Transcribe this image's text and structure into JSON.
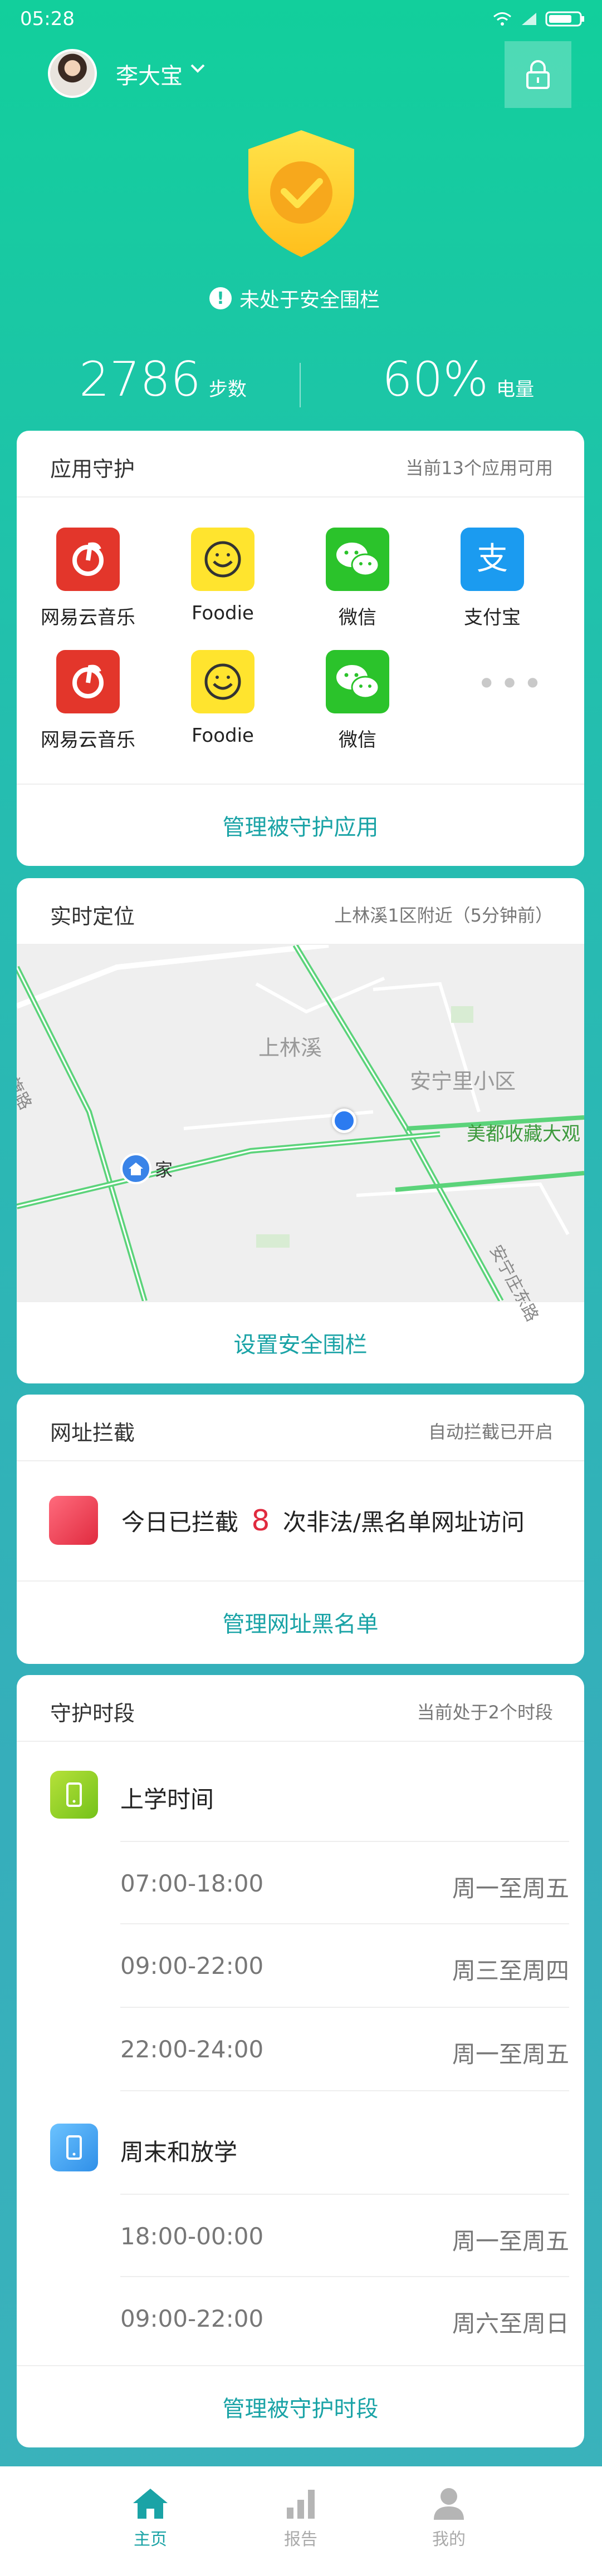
{
  "status_bar": {
    "time": "05:28"
  },
  "header": {
    "user_name": "李大宝",
    "warning_text": "未处于安全围栏",
    "steps_value": "2786",
    "steps_unit": "步数",
    "battery_value": "60%",
    "battery_unit": "电量"
  },
  "app_guard": {
    "title": "应用守护",
    "subtitle": "当前13个应用可用",
    "apps": [
      {
        "label": "网易云音乐",
        "icon": "netease-music-icon"
      },
      {
        "label": "Foodie",
        "icon": "foodie-icon"
      },
      {
        "label": "微信",
        "icon": "wechat-icon"
      },
      {
        "label": "支付宝",
        "icon": "alipay-icon"
      },
      {
        "label": "网易云音乐",
        "icon": "netease-music-icon"
      },
      {
        "label": "Foodie",
        "icon": "foodie-icon"
      },
      {
        "label": "微信",
        "icon": "wechat-icon"
      }
    ],
    "more_label": "•••",
    "footer": "管理被守护应用"
  },
  "location": {
    "title": "实时定位",
    "subtitle": "上林溪1区附近（5分钟前）",
    "map_labels": {
      "shanglinxi": "上林溪",
      "anningli": "安宁里小区",
      "meidu": "美都收藏大观",
      "home": "家",
      "road_left": "西二旗路",
      "road_right": "安宁庄东路"
    },
    "footer": "设置安全围栏"
  },
  "url_block": {
    "title": "网址拦截",
    "subtitle": "自动拦截已开启",
    "prefix": "今日已拦截",
    "count": "8",
    "suffix": "次非法/黑名单网址访问",
    "footer": "管理网址黑名单"
  },
  "time_guard": {
    "title": "守护时段",
    "subtitle": "当前处于2个时段",
    "groups": [
      {
        "name": "上学时间",
        "color": "#8ccf1e",
        "slots": [
          {
            "time": "07:00-18:00",
            "days": "周一至周五"
          },
          {
            "time": "09:00-22:00",
            "days": "周三至周四"
          },
          {
            "time": "22:00-24:00",
            "days": "周一至周五"
          }
        ]
      },
      {
        "name": "周末和放学",
        "color": "#3aa0f0",
        "slots": [
          {
            "time": "18:00-00:00",
            "days": "周一至周五"
          },
          {
            "time": "09:00-22:00",
            "days": "周六至周日"
          }
        ]
      }
    ],
    "footer": "管理被守护时段"
  },
  "bottom_nav": {
    "items": [
      {
        "label": "主页",
        "icon": "home-icon",
        "active": true
      },
      {
        "label": "报告",
        "icon": "bar-chart-icon",
        "active": false
      },
      {
        "label": "我的",
        "icon": "user-icon",
        "active": false
      }
    ]
  },
  "colors": {
    "accent": "#1aa3a6",
    "warning_red": "#e02b3f"
  }
}
